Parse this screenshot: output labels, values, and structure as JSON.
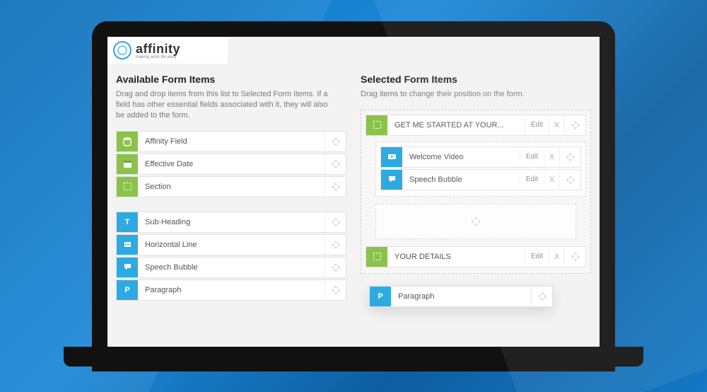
{
  "brand": {
    "name": "affinity",
    "tagline": "making work life easy"
  },
  "left": {
    "heading": "Available Form Items",
    "hint": "Drag and drop items from this list to Selected Form Items. If a field has other essential fields associated with it, they will also be added to the form.",
    "group1": [
      {
        "icon": "db",
        "color": "green",
        "label": "Affinity Field"
      },
      {
        "icon": "cal",
        "color": "green",
        "label": "Effective Date"
      },
      {
        "icon": "sect",
        "color": "green",
        "label": "Section"
      }
    ],
    "group2": [
      {
        "icon": "T",
        "color": "blue",
        "label": "Sub-Heading"
      },
      {
        "icon": "hr",
        "color": "blue",
        "label": "Horizontal Line"
      },
      {
        "icon": "sp",
        "color": "blue",
        "label": "Speech Bubble"
      },
      {
        "icon": "P",
        "color": "blue",
        "label": "Paragraph"
      }
    ]
  },
  "right": {
    "heading": "Selected Form Items",
    "hint": "Drag items to change their position on the form.",
    "sections": [
      {
        "header": {
          "icon": "sect",
          "color": "green",
          "label": "GET ME STARTED AT YOUR...",
          "edit": "Edit",
          "x": "X"
        },
        "children": [
          {
            "icon": "vid",
            "color": "blue",
            "label": "Welcome Video",
            "edit": "Edit",
            "x": "X"
          },
          {
            "icon": "sp",
            "color": "blue",
            "label": "Speech Bubble",
            "edit": "Edit",
            "x": "X"
          }
        ]
      },
      {
        "header": {
          "icon": "sect",
          "color": "green",
          "label": "YOUR DETAILS",
          "edit": "Edit",
          "x": "X"
        }
      }
    ]
  },
  "drag": {
    "icon": "P",
    "color": "blue",
    "label": "Paragraph"
  }
}
